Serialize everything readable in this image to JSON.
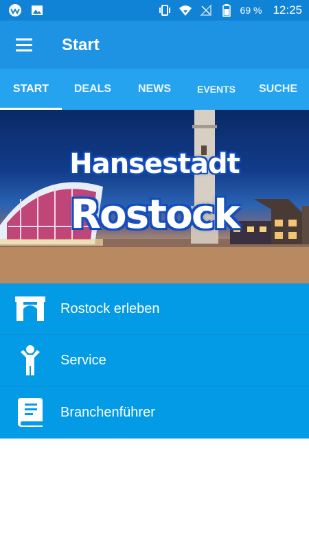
{
  "statusbar": {
    "battery_text": "69 %",
    "time": "12:25"
  },
  "appbar": {
    "title": "Start"
  },
  "tabs": [
    {
      "label": "START",
      "active": true
    },
    {
      "label": "DEALS",
      "active": false
    },
    {
      "label": "NEWS",
      "active": false
    },
    {
      "label": "EVENTS",
      "active": false
    },
    {
      "label": "SUCHE",
      "active": false
    }
  ],
  "hero": {
    "line1": "Hansestadt",
    "line2": "Rostock"
  },
  "menu": [
    {
      "label": "Rostock erleben",
      "icon": "gate-icon"
    },
    {
      "label": "Service",
      "icon": "person-icon"
    },
    {
      "label": "Branchenführer",
      "icon": "book-icon"
    }
  ],
  "colors": {
    "statusbar": "#1183d6",
    "appbar": "#1e93e4",
    "tabs": "#26a3ee",
    "menu": "#039be5"
  }
}
